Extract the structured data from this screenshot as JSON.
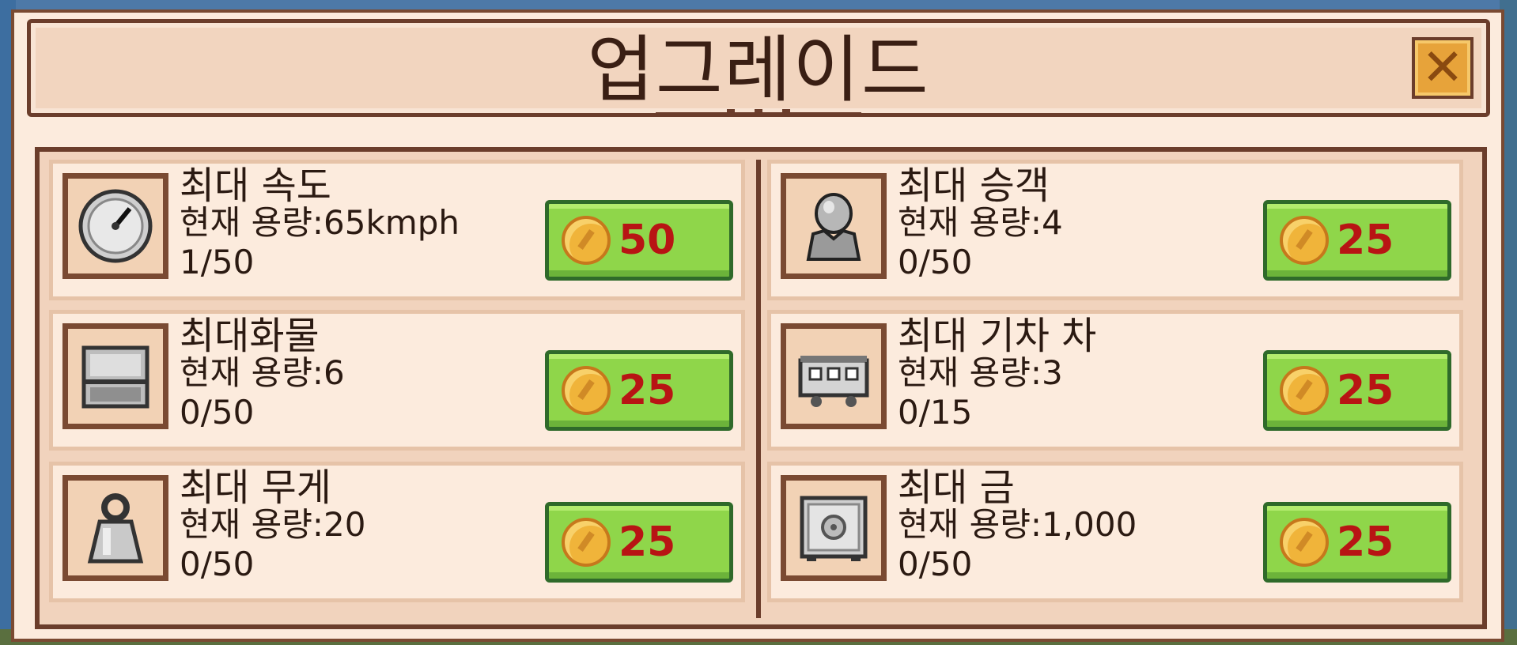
{
  "dialog": {
    "title": "업그레이드",
    "close_icon": "close-icon"
  },
  "upgrades": [
    {
      "name": "최대 속도",
      "capacity": "현재 용량:65kmph",
      "level": "1/50",
      "price": "50",
      "icon": "speedometer-icon"
    },
    {
      "name": "최대 승객",
      "capacity": "현재 용량:4",
      "level": "0/50",
      "price": "25",
      "icon": "passenger-icon"
    },
    {
      "name": "최대화물",
      "capacity": "현재 용량:6",
      "level": "0/50",
      "price": "25",
      "icon": "cargo-icon"
    },
    {
      "name": "최대 기차 차",
      "capacity": "현재 용량:3",
      "level": "0/15",
      "price": "25",
      "icon": "train-car-icon"
    },
    {
      "name": "최대 무게",
      "capacity": "현재 용량:20",
      "level": "0/50",
      "price": "25",
      "icon": "weight-icon"
    },
    {
      "name": "최대 금",
      "capacity": "현재 용량:1,000",
      "level": "0/50",
      "price": "25",
      "icon": "safe-icon"
    }
  ],
  "colors": {
    "frame": "#6b3d2b",
    "button": "#8fd64a",
    "price": "#b81414",
    "coin": "#f0b43a"
  }
}
